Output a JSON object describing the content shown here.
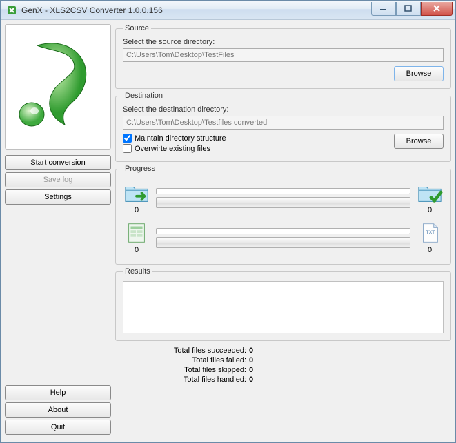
{
  "window": {
    "title": "GenX - XLS2CSV Converter 1.0.0.156"
  },
  "sidebar": {
    "start": "Start conversion",
    "savelog": "Save log",
    "settings": "Settings",
    "help": "Help",
    "about": "About",
    "quit": "Quit"
  },
  "source": {
    "legend": "Source",
    "label": "Select the source directory:",
    "path": "C:\\Users\\Tom\\Desktop\\TestFiles",
    "browse": "Browse"
  },
  "destination": {
    "legend": "Destination",
    "label": "Select the destination directory:",
    "path": "C:\\Users\\Tom\\Desktop\\Testfiles converted",
    "maintain_label": "Maintain directory structure",
    "maintain_checked": true,
    "overwrite_label": "Overwirte existing files",
    "overwrite_checked": false,
    "browse": "Browse"
  },
  "progress": {
    "legend": "Progress",
    "in_count": "0",
    "out_count": "0",
    "file_in_count": "0",
    "file_out_count": "0"
  },
  "results": {
    "legend": "Results",
    "text": ""
  },
  "totals": {
    "succeeded_label": "Total files succeeded:",
    "succeeded": "0",
    "failed_label": "Total files failed:",
    "failed": "0",
    "skipped_label": "Total files skipped:",
    "skipped": "0",
    "handled_label": "Total files handled:",
    "handled": "0"
  }
}
